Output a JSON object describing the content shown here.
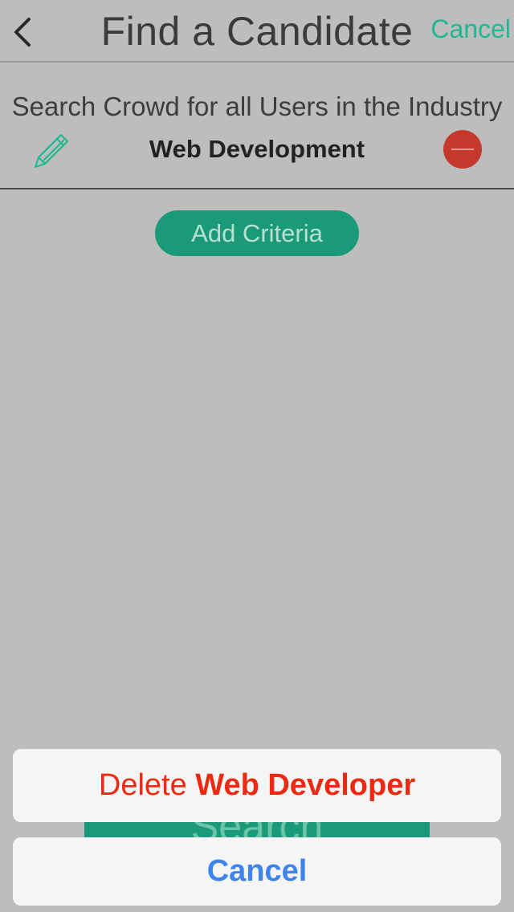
{
  "nav": {
    "title": "Find a Candidate",
    "cancel_label": "Cancel"
  },
  "criteria": {
    "label": "Search Crowd for all Users in the Industry",
    "value": "Web Development"
  },
  "add_criteria_label": "Add Criteria",
  "search_label": "Search",
  "action_sheet": {
    "delete_prefix": "Delete",
    "delete_name": "Web Developer",
    "cancel_label": "Cancel"
  },
  "colors": {
    "accent": "#1fb890",
    "button_green": "#1a9a78",
    "destructive": "#ea2a12",
    "remove_red": "#c5392c",
    "sheet_cancel": "#3d85ec",
    "overlay_gray": "#bdbdbd"
  }
}
